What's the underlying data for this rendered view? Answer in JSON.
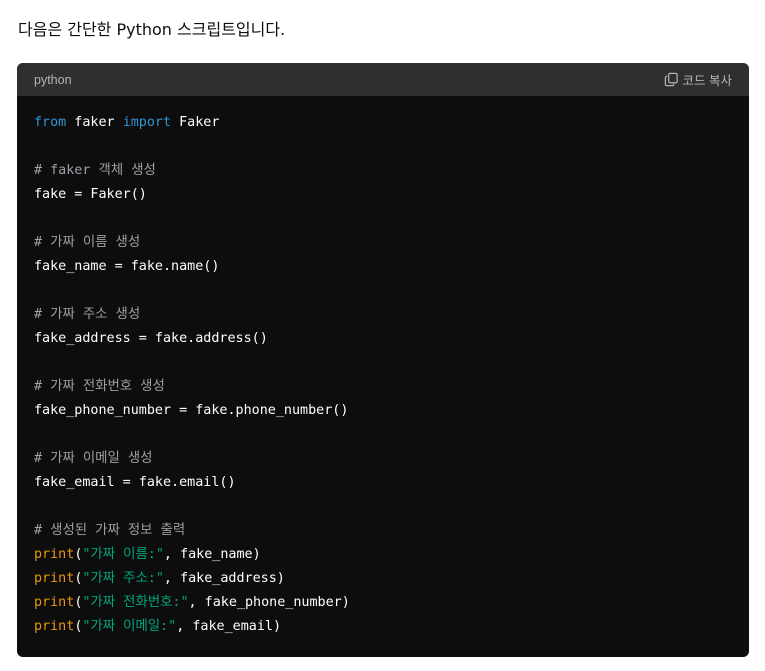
{
  "intro_text": "다음은 간단한 Python 스크립트입니다.",
  "code_block": {
    "language": "python",
    "copy_label": "코드 복사",
    "copy_icon": "copy-icon",
    "colors": {
      "background": "#0d0d0d",
      "header": "#2f2f2f",
      "keyword": "#2e95d3",
      "comment": "#9aa0a6",
      "builtin": "#e9950c",
      "string": "#00a67d",
      "text": "#ffffff"
    },
    "lines": [
      [
        {
          "t": "from",
          "c": "kw"
        },
        {
          "t": " faker ",
          "c": ""
        },
        {
          "t": "import",
          "c": "kw"
        },
        {
          "t": " Faker",
          "c": ""
        }
      ],
      [],
      [
        {
          "t": "# faker 객체 생성",
          "c": "cm"
        }
      ],
      [
        {
          "t": "fake = Faker()",
          "c": ""
        }
      ],
      [],
      [
        {
          "t": "# 가짜 이름 생성",
          "c": "cm"
        }
      ],
      [
        {
          "t": "fake_name = fake.name()",
          "c": ""
        }
      ],
      [],
      [
        {
          "t": "# 가짜 주소 생성",
          "c": "cm"
        }
      ],
      [
        {
          "t": "fake_address = fake.address()",
          "c": ""
        }
      ],
      [],
      [
        {
          "t": "# 가짜 전화번호 생성",
          "c": "cm"
        }
      ],
      [
        {
          "t": "fake_phone_number = fake.phone_number()",
          "c": ""
        }
      ],
      [],
      [
        {
          "t": "# 가짜 이메일 생성",
          "c": "cm"
        }
      ],
      [
        {
          "t": "fake_email = fake.email()",
          "c": ""
        }
      ],
      [],
      [
        {
          "t": "# 생성된 가짜 정보 출력",
          "c": "cm"
        }
      ],
      [
        {
          "t": "print",
          "c": "fn"
        },
        {
          "t": "(",
          "c": ""
        },
        {
          "t": "\"가짜 이름:\"",
          "c": "st"
        },
        {
          "t": ", fake_name)",
          "c": ""
        }
      ],
      [
        {
          "t": "print",
          "c": "fn"
        },
        {
          "t": "(",
          "c": ""
        },
        {
          "t": "\"가짜 주소:\"",
          "c": "st"
        },
        {
          "t": ", fake_address)",
          "c": ""
        }
      ],
      [
        {
          "t": "print",
          "c": "fn"
        },
        {
          "t": "(",
          "c": ""
        },
        {
          "t": "\"가짜 전화번호:\"",
          "c": "st"
        },
        {
          "t": ", fake_phone_number)",
          "c": ""
        }
      ],
      [
        {
          "t": "print",
          "c": "fn"
        },
        {
          "t": "(",
          "c": ""
        },
        {
          "t": "\"가짜 이메일:\"",
          "c": "st"
        },
        {
          "t": ", fake_email)",
          "c": ""
        }
      ]
    ]
  }
}
